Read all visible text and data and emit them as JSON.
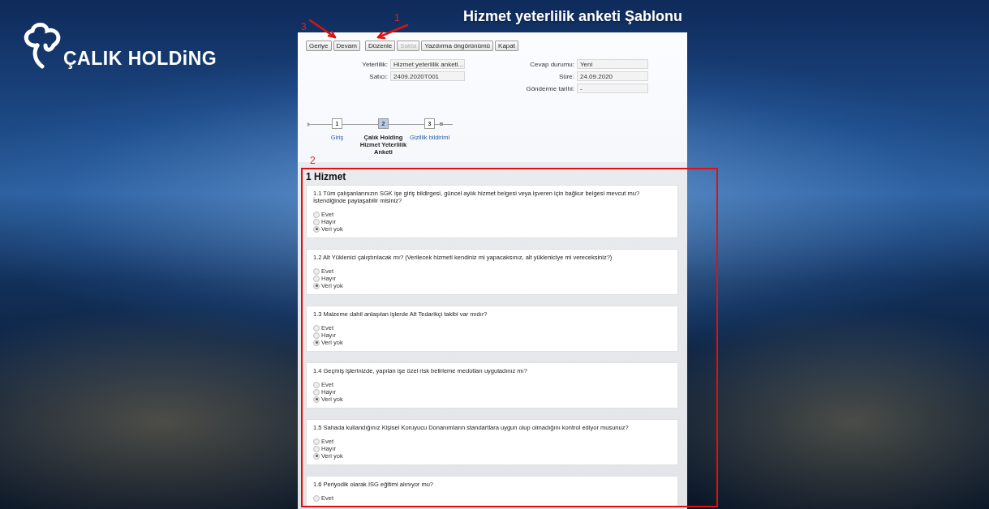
{
  "logo": {
    "text": "ÇALIK HOLDiNG"
  },
  "page_title": "Hizmet yeterlilik anketi Şablonu",
  "toolbar": {
    "groups": [
      [
        {
          "label": "Geriye",
          "disabled": false
        },
        {
          "label": "Devam",
          "disabled": false
        }
      ],
      [
        {
          "label": "Düzenle",
          "disabled": false
        },
        {
          "label": "Sakla",
          "disabled": true
        },
        {
          "label": "Yazdırma öngörünümü",
          "disabled": false
        },
        {
          "label": "Kapat",
          "disabled": false
        }
      ]
    ]
  },
  "fields_left": [
    {
      "label": "Yeterlilik:",
      "value": "Hizmet yeterlilik anketi..."
    },
    {
      "label": "Satıcı:",
      "value": "2409.2020T001"
    }
  ],
  "fields_right": [
    {
      "label": "Cevap durumu:",
      "value": "Yeni"
    },
    {
      "label": "Süre:",
      "value": "24.09.2020"
    },
    {
      "label": "Gönderme tarihi:",
      "value": "-"
    }
  ],
  "steps": [
    {
      "number": "1",
      "label": "Giriş",
      "selected": false
    },
    {
      "number": "2",
      "label": "Çalık Holding Hizmet Yeterlilik Anketi",
      "selected": true
    },
    {
      "number": "3",
      "label": "Gizlilik bildirimi",
      "selected": false
    }
  ],
  "section": {
    "title": "1 Hizmet",
    "questions": [
      {
        "text": "1.1 Tüm çalışanlarınızın SGK işe giriş bildirgesi, güncel aylık hizmet belgesi veya işveren için bağkur belgesi mevcut mu? İstendiğinde paylaşabilir misiniz?",
        "options": [
          {
            "label": "Evet",
            "selected": false
          },
          {
            "label": "Hayır",
            "selected": false
          },
          {
            "label": "Veri yok",
            "selected": true
          }
        ]
      },
      {
        "text": "1.2 Alt Yüklenici çalıştırılacak mı? (Verilecek hizmeti kendiniz mi yapacaksınız, alt yükleniciye mi vereceksiniz?)",
        "options": [
          {
            "label": "Evet",
            "selected": false
          },
          {
            "label": "Hayır",
            "selected": false
          },
          {
            "label": "Veri yok",
            "selected": true
          }
        ]
      },
      {
        "text": "1.3 Malzeme dahil anlaşılan işlerde Alt Tedarikçi takibi var mıdır?",
        "options": [
          {
            "label": "Evet",
            "selected": false
          },
          {
            "label": "Hayır",
            "selected": false
          },
          {
            "label": "Veri yok",
            "selected": true
          }
        ]
      },
      {
        "text": "1.4 Geçmiş işlerinizde, yapılan işe özel risk belirleme medotları uyguladınız mı?",
        "options": [
          {
            "label": "Evet",
            "selected": false
          },
          {
            "label": "Hayır",
            "selected": false
          },
          {
            "label": "Veri yok",
            "selected": true
          }
        ]
      },
      {
        "text": "1.5 Sahada kullandığınız Kişisel Koruyucu Donanımların standartlara uygun olup olmadığını kontrol ediyor musunuz?",
        "options": [
          {
            "label": "Evet",
            "selected": false
          },
          {
            "label": "Hayır",
            "selected": false
          },
          {
            "label": "Veri yok",
            "selected": true
          }
        ]
      },
      {
        "text": "1.6 Periyodik olarak İSG eğitimi alınıyor mu?",
        "options": [
          {
            "label": "Evet",
            "selected": false
          }
        ]
      }
    ]
  },
  "annotations": [
    {
      "text": "3"
    },
    {
      "text": "1"
    },
    {
      "text": "2"
    }
  ]
}
